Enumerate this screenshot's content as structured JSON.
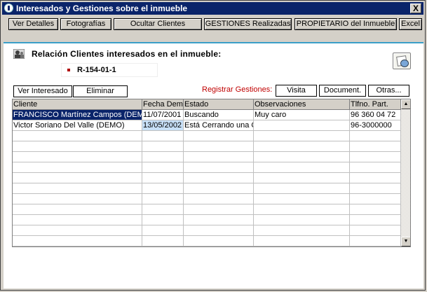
{
  "window": {
    "title": "Interesados y Gestiones sobre el inmueble",
    "close_label": "X"
  },
  "toolbar": {
    "buttons": [
      "Ver Detalles",
      "Fotografías",
      "Ocultar Clientes",
      "GESTIONES Realizadas",
      "PROPIETARIO del Inmueble",
      "Excel"
    ]
  },
  "main": {
    "heading": "Relación Clientes interesados en el inmueble:",
    "reference": "R-154-01-1",
    "actions": {
      "ver_interesado": "Ver Interesado",
      "eliminar": "Eliminar"
    },
    "registrar": {
      "label": "Registrar Gestiones:",
      "visita": "Visita",
      "document": "Document.",
      "otras": "Otras..."
    }
  },
  "grid": {
    "columns": [
      "Cliente",
      "Fecha Dem.",
      "Estado",
      "Observaciones",
      "Tlfno. Part."
    ],
    "rows": [
      [
        "FRANCISCO Martínez Campos (DEMO)",
        "11/07/2001",
        "Buscando",
        "Muy caro",
        "96 360 04 72"
      ],
      [
        "Victor Soriano Del Valle (DEMO)",
        "13/05/2002",
        "Está Cerrando una Operación",
        "",
        "96-3000000"
      ]
    ],
    "selected_row": 0,
    "highlight_color": "#0a246a",
    "focus_cell_color": "#c8e0f8"
  },
  "colors": {
    "title_bar": "#0a246a",
    "accent_line": "#3a9ec8",
    "label_red": "#c00000"
  },
  "icons": {
    "app": "app-icon",
    "heading": "clients-icon",
    "doc": "document-disc-icon"
  }
}
